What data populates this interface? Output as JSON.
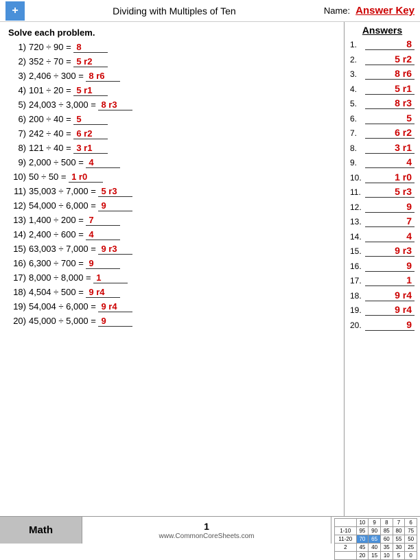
{
  "header": {
    "title": "Dividing with Multiples of Ten",
    "name_label": "Name:",
    "answer_key": "Answer Key",
    "logo_symbol": "+"
  },
  "problems_section": {
    "solve_label": "Solve each problem.",
    "problems": [
      {
        "num": "1)",
        "text": "720 ÷ 90 =",
        "answer": "8"
      },
      {
        "num": "2)",
        "text": "352 ÷ 70 =",
        "answer": "5 r2"
      },
      {
        "num": "3)",
        "text": "2,406 ÷ 300 =",
        "answer": "8 r6"
      },
      {
        "num": "4)",
        "text": "101 ÷ 20 =",
        "answer": "5 r1"
      },
      {
        "num": "5)",
        "text": "24,003 ÷ 3,000 =",
        "answer": "8 r3"
      },
      {
        "num": "6)",
        "text": "200 ÷ 40 =",
        "answer": "5"
      },
      {
        "num": "7)",
        "text": "242 ÷ 40 =",
        "answer": "6 r2"
      },
      {
        "num": "8)",
        "text": "121 ÷ 40 =",
        "answer": "3 r1"
      },
      {
        "num": "9)",
        "text": "2,000 ÷ 500 =",
        "answer": "4"
      },
      {
        "num": "10)",
        "text": "50 ÷ 50 =",
        "answer": "1 r0"
      },
      {
        "num": "11)",
        "text": "35,003 ÷ 7,000 =",
        "answer": "5 r3"
      },
      {
        "num": "12)",
        "text": "54,000 ÷ 6,000 =",
        "answer": "9"
      },
      {
        "num": "13)",
        "text": "1,400 ÷ 200 =",
        "answer": "7"
      },
      {
        "num": "14)",
        "text": "2,400 ÷ 600 =",
        "answer": "4"
      },
      {
        "num": "15)",
        "text": "63,003 ÷ 7,000 =",
        "answer": "9 r3"
      },
      {
        "num": "16)",
        "text": "6,300 ÷ 700 =",
        "answer": "9"
      },
      {
        "num": "17)",
        "text": "8,000 ÷ 8,000 =",
        "answer": "1"
      },
      {
        "num": "18)",
        "text": "4,504 ÷ 500 =",
        "answer": "9 r4"
      },
      {
        "num": "19)",
        "text": "54,004 ÷ 6,000 =",
        "answer": "9 r4"
      },
      {
        "num": "20)",
        "text": "45,000 ÷ 5,000 =",
        "answer": "9"
      }
    ]
  },
  "answers_section": {
    "title": "Answers",
    "answers": [
      {
        "num": "1.",
        "val": "8"
      },
      {
        "num": "2.",
        "val": "5 r2"
      },
      {
        "num": "3.",
        "val": "8 r6"
      },
      {
        "num": "4.",
        "val": "5 r1"
      },
      {
        "num": "5.",
        "val": "8 r3"
      },
      {
        "num": "6.",
        "val": "5"
      },
      {
        "num": "7.",
        "val": "6 r2"
      },
      {
        "num": "8.",
        "val": "3 r1"
      },
      {
        "num": "9.",
        "val": "4"
      },
      {
        "num": "10.",
        "val": "1 r0"
      },
      {
        "num": "11.",
        "val": "5 r3"
      },
      {
        "num": "12.",
        "val": "9"
      },
      {
        "num": "13.",
        "val": "7"
      },
      {
        "num": "14.",
        "val": "4"
      },
      {
        "num": "15.",
        "val": "9 r3"
      },
      {
        "num": "16.",
        "val": "9"
      },
      {
        "num": "17.",
        "val": "1"
      },
      {
        "num": "18.",
        "val": "9 r4"
      },
      {
        "num": "19.",
        "val": "9 r4"
      },
      {
        "num": "20.",
        "val": "9"
      }
    ]
  },
  "footer": {
    "math_label": "Math",
    "site": "www.CommonCoreSheets.com",
    "page": "1",
    "score_rows": [
      {
        "label": "1-10",
        "scores": [
          "95",
          "90",
          "85",
          "80",
          "75"
        ]
      },
      {
        "label": "11-20",
        "scores": [
          "70",
          "65",
          "60",
          "55",
          "50"
        ]
      },
      {
        "label": "",
        "scores": [
          "45",
          "40",
          "35",
          "30",
          "25"
        ]
      },
      {
        "label": "",
        "scores": [
          "20",
          "15",
          "10",
          "5",
          "0"
        ]
      }
    ],
    "score_headers": [
      "",
      "10",
      "9",
      "8",
      "7",
      "6"
    ],
    "highlighted_cols": [
      1,
      2
    ]
  }
}
